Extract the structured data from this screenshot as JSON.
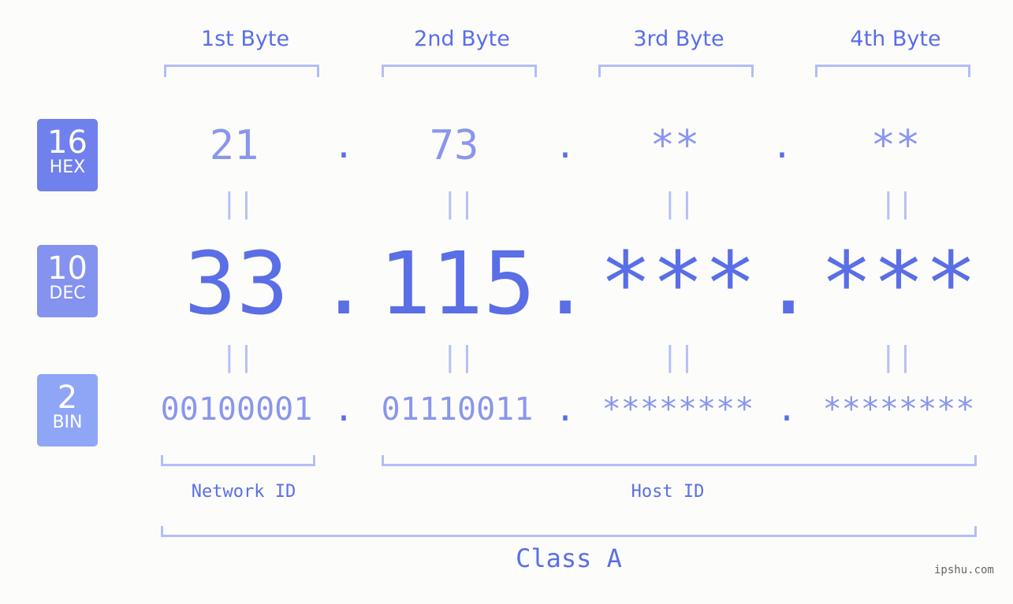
{
  "colors": {
    "hex_badge": "#7080ec",
    "dec_badge": "#8492f0",
    "bin_badge": "#8fa6f7",
    "primary": "#5a6ee6",
    "light": "#8a96ec",
    "bracket": "#b3bdf7"
  },
  "badges": [
    {
      "num": "16",
      "label": "HEX"
    },
    {
      "num": "10",
      "label": "DEC"
    },
    {
      "num": "2",
      "label": "BIN"
    }
  ],
  "byte_headers": [
    "1st Byte",
    "2nd Byte",
    "3rd Byte",
    "4th Byte"
  ],
  "hex": [
    "21",
    "73",
    "**",
    "**"
  ],
  "dec": [
    "33",
    "115",
    "***",
    "***"
  ],
  "bin": [
    "00100001",
    "01110011",
    "********",
    "********"
  ],
  "separator": ".",
  "equals": "||",
  "network_id_label": "Network ID",
  "host_id_label": "Host ID",
  "class_label": "Class A",
  "watermark": "ipshu.com"
}
